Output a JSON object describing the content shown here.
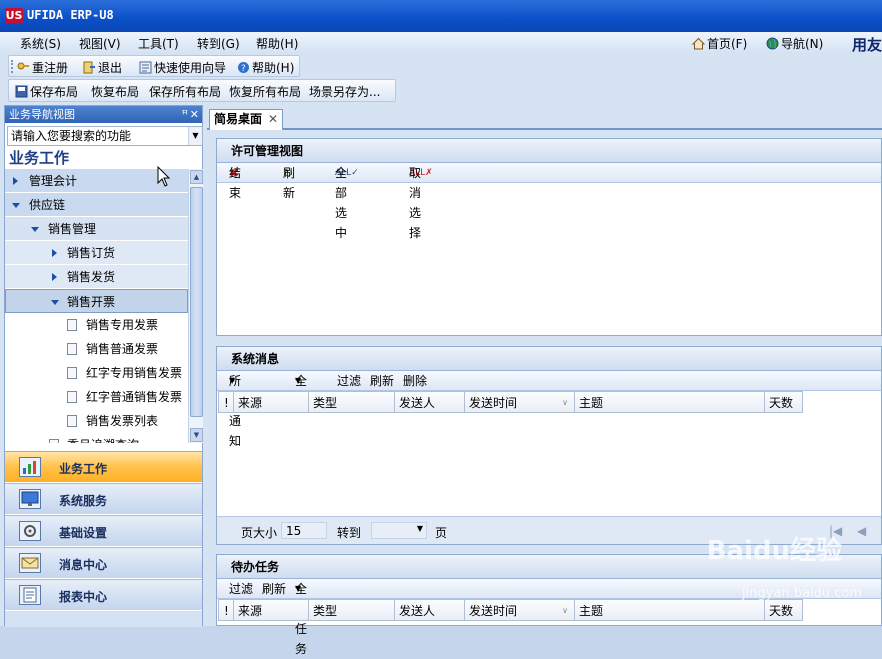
{
  "window": {
    "title": "UFIDA ERP-U8",
    "logo": "US"
  },
  "menu": [
    "系统(S)",
    "视图(V)",
    "工具(T)",
    "转到(G)",
    "帮助(H)"
  ],
  "top_links": {
    "home": "首页(F)",
    "nav": "导航(N)",
    "brand": "用友"
  },
  "toolbar1": {
    "register": "重注册",
    "exit": "退出",
    "quick_guide": "快速使用向导",
    "help": "帮助(H)"
  },
  "toolbar2": {
    "save_layout": "保存布局",
    "restore_layout": "恢复布局",
    "save_all_layout": "保存所有布局",
    "restore_all_layout": "恢复所有布局",
    "save_scene_as": "场景另存为..."
  },
  "left_pane": {
    "header": "业务导航视图",
    "search_placeholder": "请输入您要搜索的功能",
    "section_title": "业务工作",
    "tree": [
      {
        "label": "管理会计",
        "level": 0,
        "expanded": false
      },
      {
        "label": "供应链",
        "level": 0,
        "expanded": true
      },
      {
        "label": "销售管理",
        "level": 1,
        "expanded": true
      },
      {
        "label": "销售订货",
        "level": 2,
        "expanded": false
      },
      {
        "label": "销售发货",
        "level": 2,
        "expanded": false
      },
      {
        "label": "销售开票",
        "level": 2,
        "expanded": true
      },
      {
        "label": "销售专用发票",
        "level": 3
      },
      {
        "label": "销售普通发票",
        "level": 3
      },
      {
        "label": "红字专用销售发票",
        "level": 3
      },
      {
        "label": "红字普通销售发票",
        "level": 3
      },
      {
        "label": "销售发票列表",
        "level": 3
      },
      {
        "label": "委吕追溯查询",
        "level": 2
      }
    ],
    "nav_buttons": [
      "业务工作",
      "系统服务",
      "基础设置",
      "消息中心",
      "报表中心"
    ],
    "active_nav": "业务工作"
  },
  "tab": {
    "label": "简易桌面"
  },
  "license_panel": {
    "title": "许可管理视图",
    "tools": [
      "结束",
      "刷新",
      "全部选中",
      "取消选择"
    ]
  },
  "messages_panel": {
    "title": "系统消息",
    "tools": [
      "所有通知",
      "全部",
      "过滤",
      "刷新",
      "删除"
    ],
    "columns": [
      "!",
      "来源",
      "类型",
      "发送人",
      "发送时间",
      "主题",
      "天数"
    ],
    "pager": {
      "page_size_label": "页大小",
      "page_size": "15",
      "goto_label": "转到",
      "page_unit": "页"
    }
  },
  "todo_panel": {
    "title": "待办任务",
    "tools": [
      "过滤",
      "刷新",
      "全部任务"
    ],
    "columns": [
      "!",
      "来源",
      "类型",
      "发送人",
      "发送时间",
      "主题",
      "天数"
    ]
  },
  "watermark": {
    "main": "Baidu经验",
    "sub": "jingyan.baidu.com"
  }
}
